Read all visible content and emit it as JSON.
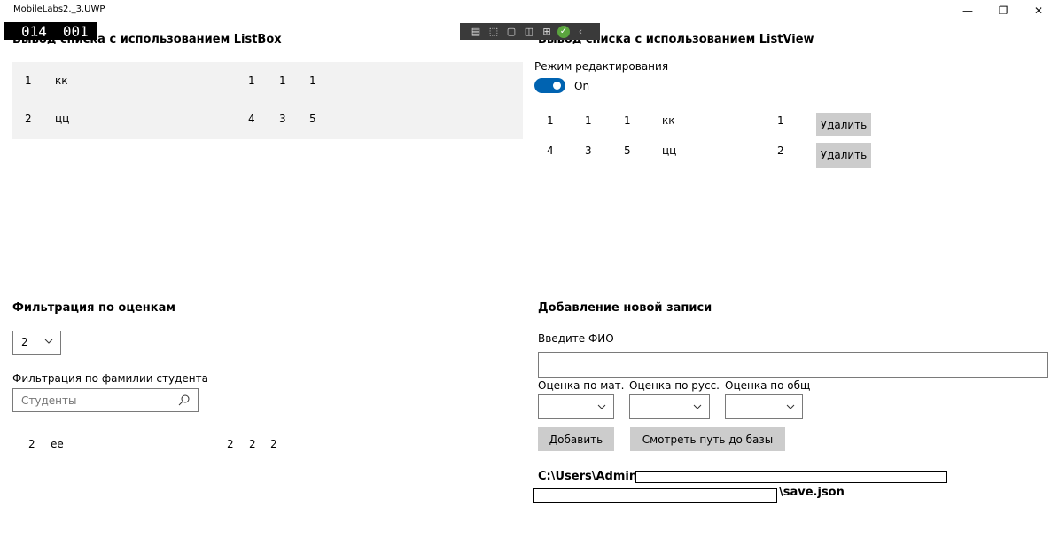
{
  "window": {
    "title": "MobileLabs2._3.UWP",
    "minimize_glyph": "—",
    "maximize_glyph": "❐",
    "close_glyph": "✕"
  },
  "frame_counter": {
    "left": "014",
    "right": "001"
  },
  "debug_toolbar": {
    "icons": [
      "go-to-live-visual-tree-icon",
      "select-element-icon",
      "display-layout-adorners-icon",
      "track-focus-icon",
      "hot-reload-icon",
      "checkmark-icon",
      "collapse-chevron-icon"
    ]
  },
  "listbox_section": {
    "title": "Вывод списка с использованием ListBox",
    "rows": [
      {
        "id": "1",
        "name": "кк",
        "m": "1",
        "r": "1",
        "o": "1"
      },
      {
        "id": "2",
        "name": "цц",
        "m": "4",
        "r": "3",
        "o": "5"
      }
    ]
  },
  "listview_section": {
    "title": "Вывод списка с использованием ListView",
    "edit_mode_label": "Режим редактирования",
    "toggle_state": "On",
    "rows": [
      {
        "m": "1",
        "r": "1",
        "o": "1",
        "name": "кк",
        "id": "1",
        "delete_label": "Удалить"
      },
      {
        "m": "4",
        "r": "3",
        "o": "5",
        "name": "цц",
        "id": "2",
        "delete_label": "Удалить"
      }
    ]
  },
  "filter_section": {
    "title": "Фильтрация по оценкам",
    "grade_selected": "2",
    "surname_label": "Фильтрация по фамилии студента",
    "search_placeholder": "Студенты",
    "results": [
      {
        "id": "2",
        "name": "ее",
        "m": "2",
        "r": "2",
        "o": "2"
      }
    ]
  },
  "add_section": {
    "title": "Добавление новой записи",
    "fio_label": "Введите ФИО",
    "fio_value": "",
    "math_label": "Оценка по мат.",
    "rus_label": "Оценка по русс.",
    "social_label": "Оценка по общ",
    "add_button": "Добавить",
    "show_path_button": "Смотреть путь до базы",
    "path_prefix": "C:\\Users\\Admin\\",
    "path_suffix": "\\save.json"
  }
}
